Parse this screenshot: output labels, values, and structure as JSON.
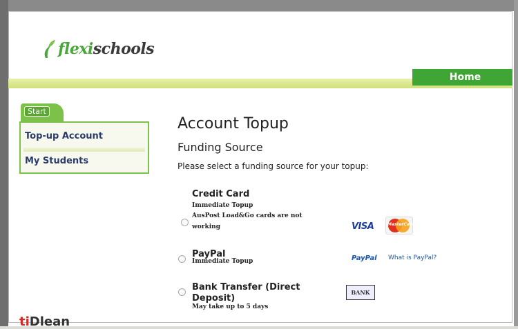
{
  "brand": {
    "name_part1": "flexi",
    "name_part2": "schools"
  },
  "nav": {
    "home_label": "Home"
  },
  "sidebar": {
    "tab_label": "Start",
    "items": [
      {
        "label": "Top-up Account"
      },
      {
        "label": "My Students"
      }
    ]
  },
  "main": {
    "title": "Account Topup",
    "subtitle": "Funding Source",
    "prompt": "Please select a funding source for your topup:",
    "options": [
      {
        "title": "Credit Card",
        "note1": "Immediate Topup",
        "note2": "AusPost Load&Go cards are not",
        "note3": "working"
      },
      {
        "title": "PayPal",
        "note1": "Immediate Topup"
      },
      {
        "title_line1": "Bank Transfer (Direct",
        "title_line2": "Deposit)",
        "note1": "May take up to 5 days"
      }
    ],
    "logos": {
      "visa": "VISA",
      "mastercard": "MasterCard",
      "paypal": "PayPal",
      "paypal_link": "What is PayPal?",
      "bank": "BANK"
    }
  },
  "footer_logo": {
    "part1": "ti",
    "part2": "Dlean"
  },
  "colors": {
    "brand_green": "#3fa535",
    "band_yellow": "#cfe07a",
    "link_blue": "#1a58b0"
  }
}
